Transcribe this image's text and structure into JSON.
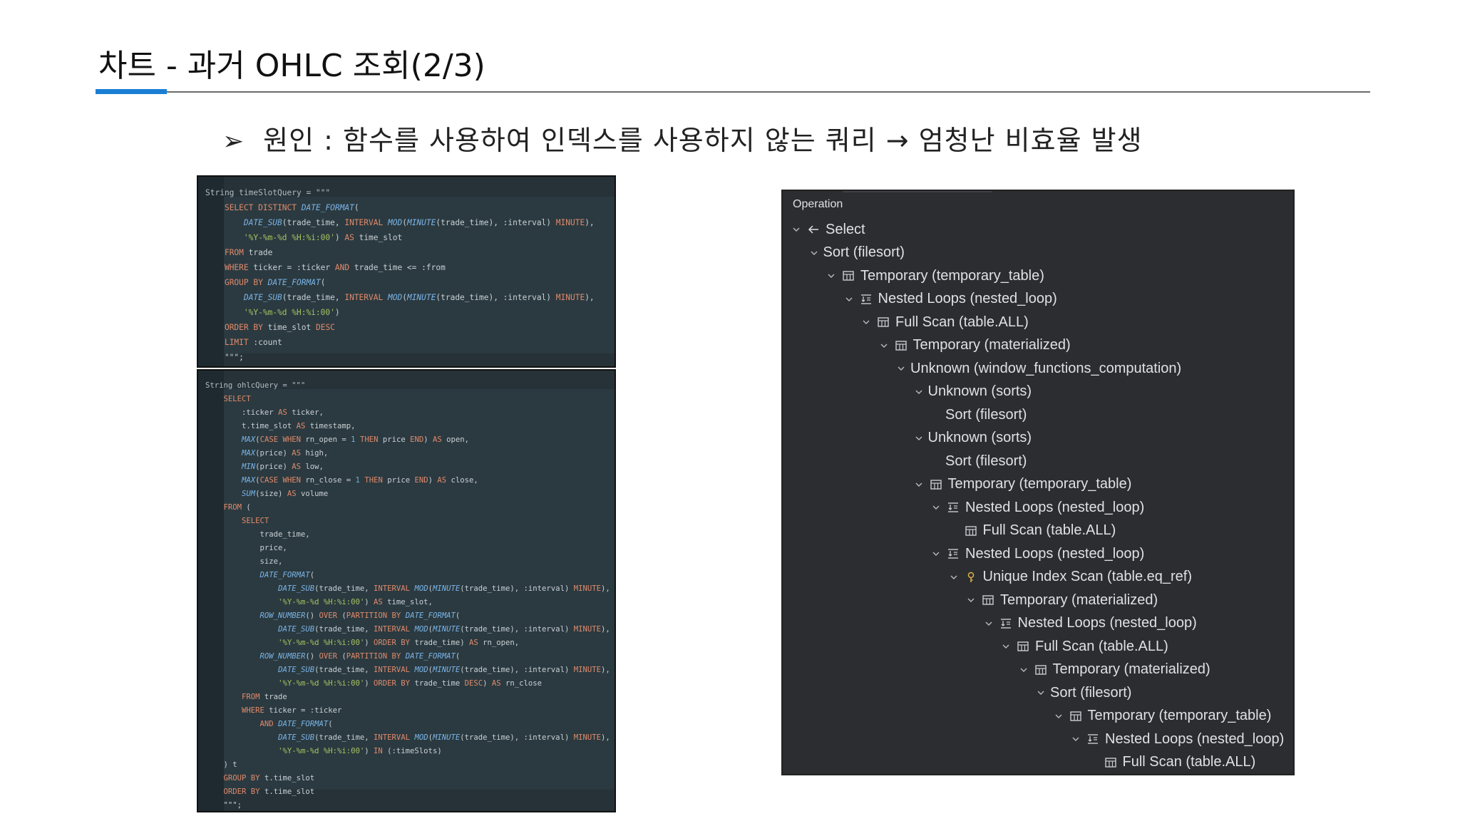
{
  "slide": {
    "title": "차트 - 과거 OHLC 조회(2/3)",
    "subtitle_arrow": "➢",
    "subtitle": "원인 : 함수를 사용하여 인덱스를 사용하지 않는 쿼리 → 엄청난 비효율 발생"
  },
  "code1": {
    "lines": [
      "String timeSlotQuery = \"\"\"",
      "    SELECT DISTINCT DATE_FORMAT(",
      "        DATE_SUB(trade_time, INTERVAL MOD(MINUTE(trade_time), :interval) MINUTE),",
      "        '%Y-%m-%d %H:%i:00') AS time_slot",
      "    FROM trade",
      "    WHERE ticker = :ticker AND trade_time <= :from",
      "    GROUP BY DATE_FORMAT(",
      "        DATE_SUB(trade_time, INTERVAL MOD(MINUTE(trade_time), :interval) MINUTE),",
      "        '%Y-%m-%d %H:%i:00')",
      "    ORDER BY time_slot DESC",
      "    LIMIT :count",
      "    \"\"\";"
    ]
  },
  "code2": {
    "lines": [
      "String ohlcQuery = \"\"\"",
      "    SELECT",
      "        :ticker AS ticker,",
      "        t.time_slot AS timestamp,",
      "        MAX(CASE WHEN rn_open = 1 THEN price END) AS open,",
      "        MAX(price) AS high,",
      "        MIN(price) AS low,",
      "        MAX(CASE WHEN rn_close = 1 THEN price END) AS close,",
      "        SUM(size) AS volume",
      "    FROM (",
      "        SELECT",
      "            trade_time,",
      "            price,",
      "            size,",
      "            DATE_FORMAT(",
      "                DATE_SUB(trade_time, INTERVAL MOD(MINUTE(trade_time), :interval) MINUTE),",
      "                '%Y-%m-%d %H:%i:00') AS time_slot,",
      "            ROW_NUMBER() OVER (PARTITION BY DATE_FORMAT(",
      "                DATE_SUB(trade_time, INTERVAL MOD(MINUTE(trade_time), :interval) MINUTE),",
      "                '%Y-%m-%d %H:%i:00') ORDER BY trade_time) AS rn_open,",
      "            ROW_NUMBER() OVER (PARTITION BY DATE_FORMAT(",
      "                DATE_SUB(trade_time, INTERVAL MOD(MINUTE(trade_time), :interval) MINUTE),",
      "                '%Y-%m-%d %H:%i:00') ORDER BY trade_time DESC) AS rn_close",
      "        FROM trade",
      "        WHERE ticker = :ticker",
      "            AND DATE_FORMAT(",
      "                DATE_SUB(trade_time, INTERVAL MOD(MINUTE(trade_time), :interval) MINUTE),",
      "                '%Y-%m-%d %H:%i:00') IN (:timeSlots)",
      "    ) t",
      "    GROUP BY t.time_slot",
      "    ORDER BY t.time_slot",
      "    \"\"\";"
    ]
  },
  "plan": {
    "header": "Operation",
    "rows": [
      {
        "label": "Select",
        "depth": 0,
        "chevron": true,
        "icon": "arrow-back-icon"
      },
      {
        "label": "Sort (filesort)",
        "depth": 1,
        "chevron": true,
        "icon": ""
      },
      {
        "label": "Temporary (temporary_table)",
        "depth": 2,
        "chevron": true,
        "icon": "table-icon"
      },
      {
        "label": "Nested Loops (nested_loop)",
        "depth": 3,
        "chevron": true,
        "icon": "nested-loop-icon"
      },
      {
        "label": "Full Scan (table.ALL)",
        "depth": 4,
        "chevron": true,
        "icon": "table-icon"
      },
      {
        "label": "Temporary (materialized)",
        "depth": 5,
        "chevron": true,
        "icon": "table-icon"
      },
      {
        "label": "Unknown (window_functions_computation)",
        "depth": 6,
        "chevron": true,
        "icon": ""
      },
      {
        "label": "Unknown (sorts)",
        "depth": 7,
        "chevron": true,
        "icon": ""
      },
      {
        "label": "Sort (filesort)",
        "depth": 8,
        "chevron": false,
        "icon": ""
      },
      {
        "label": "Unknown (sorts)",
        "depth": 7,
        "chevron": true,
        "icon": ""
      },
      {
        "label": "Sort (filesort)",
        "depth": 8,
        "chevron": false,
        "icon": ""
      },
      {
        "label": "Temporary (temporary_table)",
        "depth": 7,
        "chevron": true,
        "icon": "table-icon"
      },
      {
        "label": "Nested Loops (nested_loop)",
        "depth": 8,
        "chevron": true,
        "icon": "nested-loop-icon"
      },
      {
        "label": "Full Scan (table.ALL)",
        "depth": 9,
        "chevron": false,
        "icon": "table-icon"
      },
      {
        "label": "Nested Loops (nested_loop)",
        "depth": 8,
        "chevron": true,
        "icon": "nested-loop-icon"
      },
      {
        "label": "Unique Index Scan (table.eq_ref)",
        "depth": 9,
        "chevron": true,
        "icon": "key-icon"
      },
      {
        "label": "Temporary (materialized)",
        "depth": 10,
        "chevron": true,
        "icon": "table-icon"
      },
      {
        "label": "Nested Loops (nested_loop)",
        "depth": 11,
        "chevron": true,
        "icon": "nested-loop-icon"
      },
      {
        "label": "Full Scan (table.ALL)",
        "depth": 12,
        "chevron": true,
        "icon": "table-icon"
      },
      {
        "label": "Temporary (materialized)",
        "depth": 13,
        "chevron": true,
        "icon": "table-icon"
      },
      {
        "label": "Sort (filesort)",
        "depth": 14,
        "chevron": true,
        "icon": ""
      },
      {
        "label": "Temporary (temporary_table)",
        "depth": 15,
        "chevron": true,
        "icon": "table-icon"
      },
      {
        "label": "Nested Loops (nested_loop)",
        "depth": 16,
        "chevron": true,
        "icon": "nested-loop-icon"
      },
      {
        "label": "Full Scan (table.ALL)",
        "depth": 17,
        "chevron": false,
        "icon": "table-icon"
      }
    ]
  },
  "colors": {
    "accent": "#1a7fd4",
    "code_bg": "#263238",
    "plan_bg": "#2b2d30",
    "keyword": "#e08a6c",
    "function": "#7ab4e8",
    "string": "#a5c261",
    "number": "#6fb3d2"
  }
}
